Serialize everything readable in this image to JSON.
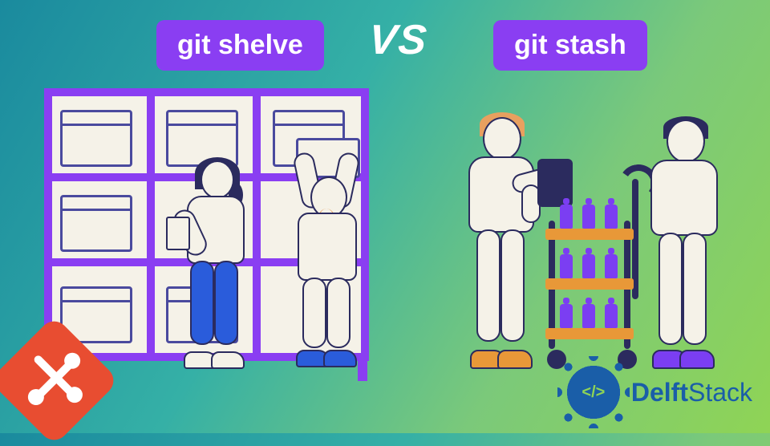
{
  "labels": {
    "left": "git shelve",
    "right": "git stash",
    "vs": "VS"
  },
  "brand": {
    "badge_text": "</>",
    "name_bold": "Delft",
    "name_thin": "Stack"
  }
}
